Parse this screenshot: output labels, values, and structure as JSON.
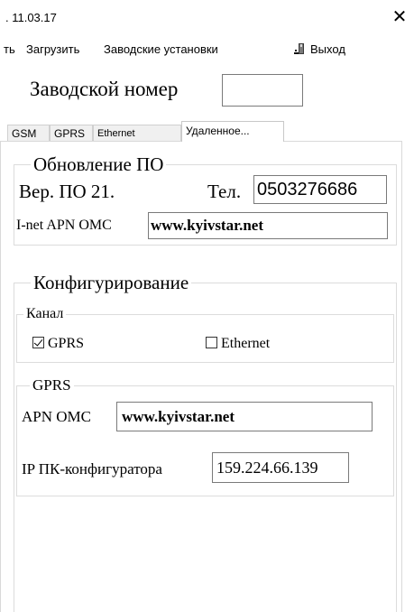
{
  "window": {
    "title": ". 11.03.17",
    "close_glyph": "✕"
  },
  "menu": {
    "item_partial": "ть",
    "load": "Загрузить",
    "factory": "Заводские установки",
    "exit": "Выход"
  },
  "serial": {
    "label": "Заводской номер",
    "value": ""
  },
  "tabs": [
    {
      "label": "GSM"
    },
    {
      "label": "GPRS"
    },
    {
      "label": "Ethernet"
    },
    {
      "label": "Удаленное..."
    }
  ],
  "firmware": {
    "legend": "Обновление ПО",
    "version_label": "Вер. ПО 21.",
    "phone_label": "Тел.",
    "phone_value": "0503276686",
    "apn_label": "I-net APN ОМС",
    "apn_value": "www.kyivstar.net"
  },
  "config": {
    "legend": "Конфигурирование",
    "channel": {
      "legend": "Канал",
      "gprs_label": "GPRS",
      "gprs_checked": true,
      "ethernet_label": "Ethernet",
      "ethernet_checked": false
    },
    "gprs": {
      "legend": "GPRS",
      "apn_label": "APN ОМС",
      "apn_value": "www.kyivstar.net",
      "ip_label": "IP ПК-конфигуратора",
      "ip_value": "159.224.66.139"
    }
  }
}
